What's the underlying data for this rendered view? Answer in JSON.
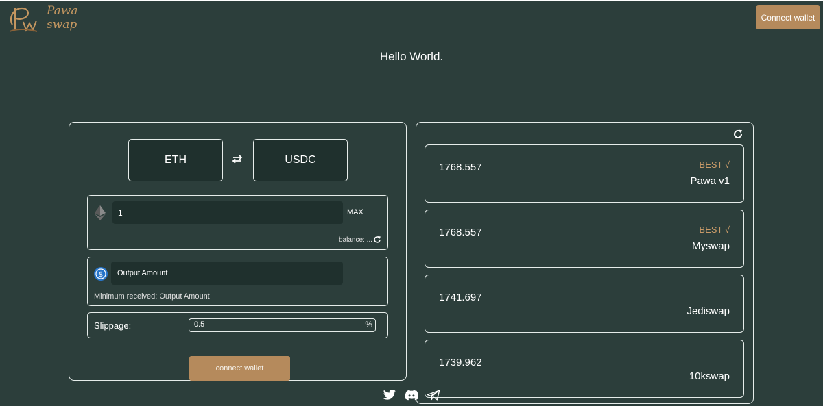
{
  "brand": {
    "name_line1": "Pawa",
    "name_line2": "swap",
    "mark_text": "PW"
  },
  "header": {
    "connect_label": "Connect wallet"
  },
  "hero": {
    "title": "Hello World."
  },
  "swap": {
    "from_token": "ETH",
    "to_token": "USDC",
    "amount_value": "1",
    "max_label": "MAX",
    "balance_label": "balance: ...",
    "output_placeholder": "Output Amount",
    "min_received": "Minimum received: Output Amount",
    "slippage_label": "Slippage:",
    "slippage_value": "0.5",
    "slippage_unit": "%",
    "connect_label": "connect wallet"
  },
  "quotes": [
    {
      "price": "1768.557",
      "best": "BEST √",
      "dex": "Pawa v1"
    },
    {
      "price": "1768.557",
      "best": "BEST √",
      "dex": "Myswap"
    },
    {
      "price": "1741.697",
      "best": "",
      "dex": "Jediswap"
    },
    {
      "price": "1739.962",
      "best": "",
      "dex": "10kswap"
    }
  ],
  "colors": {
    "background": "#2c3e3b",
    "panel_fill": "#1f302d",
    "accent": "#b58a5c",
    "best_text": "#c89a68",
    "border": "#e6ecea"
  },
  "icons": [
    "ethereum-icon",
    "usdc-icon",
    "swap-direction-icon",
    "refresh-icon",
    "twitter-icon",
    "discord-icon",
    "telegram-icon"
  ]
}
